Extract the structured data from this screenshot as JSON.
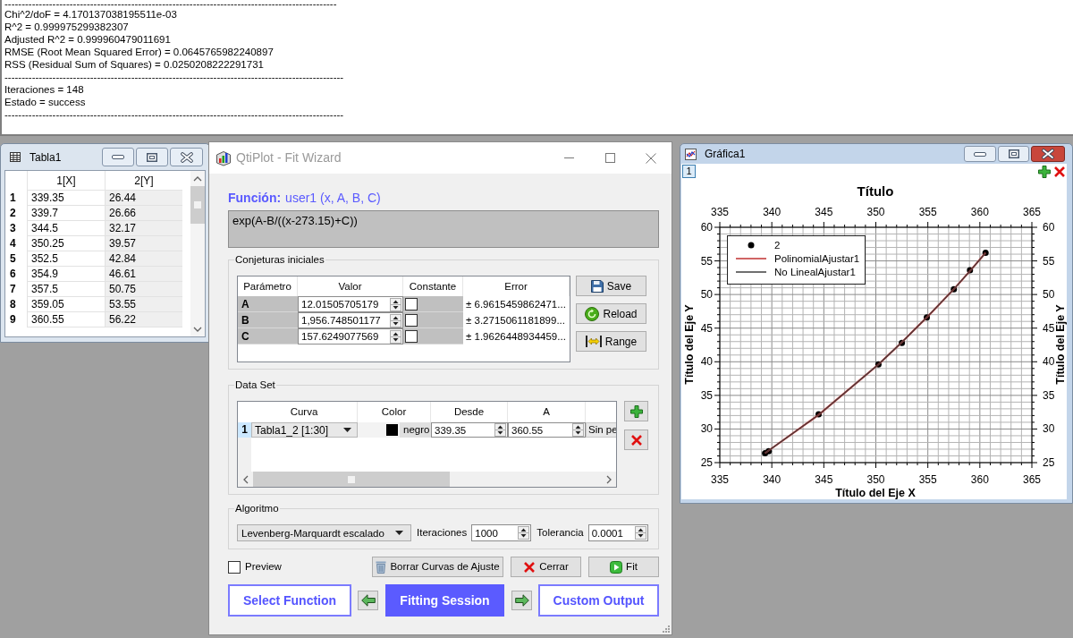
{
  "results_log": {
    "lines": [
      "-------------------------------------------------------------------------------------------------",
      "Chi^2/doF = 4.170137038195511e-03",
      "R^2 = 0.999975299382307",
      "Adjusted R^2 = 0.999960479011691",
      "RMSE (Root Mean Squared Error) = 0.0645765982240897",
      "RSS (Residual Sum of Squares) = 0.0250208222291731",
      "---------------------------------------------------------------------------------------------------",
      "Iteraciones = 148",
      "Estado = success",
      "---------------------------------------------------------------------------------------------------"
    ]
  },
  "table_window": {
    "title": "Tabla1",
    "active": false,
    "columns": [
      "1[X]",
      "2[Y]"
    ],
    "rows": [
      {
        "number": "1",
        "values": [
          "339.35",
          "26.44"
        ]
      },
      {
        "number": "2",
        "values": [
          "339.7",
          "26.66"
        ]
      },
      {
        "number": "3",
        "values": [
          "344.5",
          "32.17"
        ]
      },
      {
        "number": "4",
        "values": [
          "350.25",
          "39.57"
        ]
      },
      {
        "number": "5",
        "values": [
          "352.5",
          "42.84"
        ]
      },
      {
        "number": "6",
        "values": [
          "354.9",
          "46.61"
        ]
      },
      {
        "number": "7",
        "values": [
          "357.5",
          "50.75"
        ]
      },
      {
        "number": "8",
        "values": [
          "359.05",
          "53.55"
        ]
      },
      {
        "number": "9",
        "values": [
          "360.55",
          "56.22"
        ]
      }
    ]
  },
  "fit_wizard": {
    "title": "QtiPlot - Fit Wizard",
    "active": false,
    "function_label": "Función:",
    "function_name": "user1 (x, A, B, C)",
    "formula": "exp(A-B/((x-273.15)+C))",
    "initial_guesses": {
      "title": "Conjeturas iniciales",
      "columns": [
        "Parámetro",
        "Valor",
        "Constante",
        "Error"
      ],
      "rows": [
        {
          "parameter": "A",
          "value": "12.01505705179",
          "constant": false,
          "error": "± 6.9615459862471..."
        },
        {
          "parameter": "B",
          "value": "1,956.748501177",
          "constant": false,
          "error": "± 3.2715061181899..."
        },
        {
          "parameter": "C",
          "value": "157.6249077569",
          "constant": false,
          "error": "± 1.9626448934459..."
        }
      ],
      "buttons": [
        "Save",
        "Reload",
        "Range"
      ]
    },
    "data_set": {
      "title": "Data Set",
      "columns": [
        "Curva",
        "Color",
        "Desde",
        "A"
      ],
      "rows": [
        {
          "number": "1",
          "selected": true,
          "curve": "Tabla1_2 [1:30]",
          "color": "#000000",
          "color_name": "negro",
          "from": "339.35",
          "to": "360.55",
          "column_5": "Sin pe"
        }
      ]
    },
    "algorithm": {
      "title": "Algoritmo",
      "method": "Levenberg-Marquardt escalado",
      "iterations_label": "Iteraciones",
      "iterations": "1000",
      "tolerance_label": "Tolerancia",
      "tolerance": "0.0001"
    },
    "preview": {
      "label": "Preview",
      "checked": false
    },
    "action_buttons": [
      "Borrar Curvas de Ajuste",
      "Cerrar",
      "Fit"
    ],
    "pages": [
      {
        "label": "Select Function",
        "selected": false
      },
      {
        "label": "Fitting Session",
        "selected": true
      },
      {
        "label": "Custom Output",
        "selected": false
      }
    ]
  },
  "graph_window": {
    "title": "Gráfica1",
    "active": true,
    "layers": [
      {
        "label": "1",
        "selected": true
      }
    ],
    "top_axis_labels": [
      "335",
      "340",
      "345",
      "350",
      "355",
      "360",
      "365"
    ],
    "right_axis_labels": [
      "60",
      "55",
      "50",
      "45",
      "40",
      "35",
      "30",
      "25"
    ],
    "right_axis_title": "Título del Eje Y",
    "bottom_axis_labels": [
      "335",
      "340",
      "345",
      "350",
      "355",
      "360",
      "365"
    ],
    "chart_data": {
      "type": "scatter",
      "title": "Título",
      "xlabel": "Título del Eje X",
      "ylabel": "Título del Eje Y",
      "x": [
        339.35,
        339.7,
        344.5,
        350.25,
        352.5,
        354.9,
        357.5,
        359.05,
        360.55
      ],
      "series": [
        {
          "name": "2",
          "color": "#000000",
          "values": [
            26.4,
            26.7,
            32.2,
            39.6,
            42.8,
            46.6,
            50.8,
            53.6,
            56.2
          ]
        },
        {
          "name": "PolinomialAjustar1",
          "type": "line",
          "color": "#c03030",
          "values": [
            26.4,
            26.8,
            32.1,
            39.6,
            42.9,
            46.6,
            50.8,
            53.5,
            56.2
          ]
        },
        {
          "name": "No LinealAjustar1",
          "type": "line",
          "color": "#404040",
          "values": [
            26.4,
            26.8,
            32.1,
            39.6,
            42.9,
            46.6,
            50.8,
            53.5,
            56.2
          ]
        }
      ],
      "xlim": [
        335,
        365
      ],
      "ylim": [
        25,
        60
      ],
      "xticks": [
        335,
        340,
        345,
        350,
        355,
        360,
        365
      ],
      "yticks": [
        25,
        30,
        35,
        40,
        45,
        50,
        55,
        60
      ],
      "grid": true,
      "legend": true
    }
  }
}
